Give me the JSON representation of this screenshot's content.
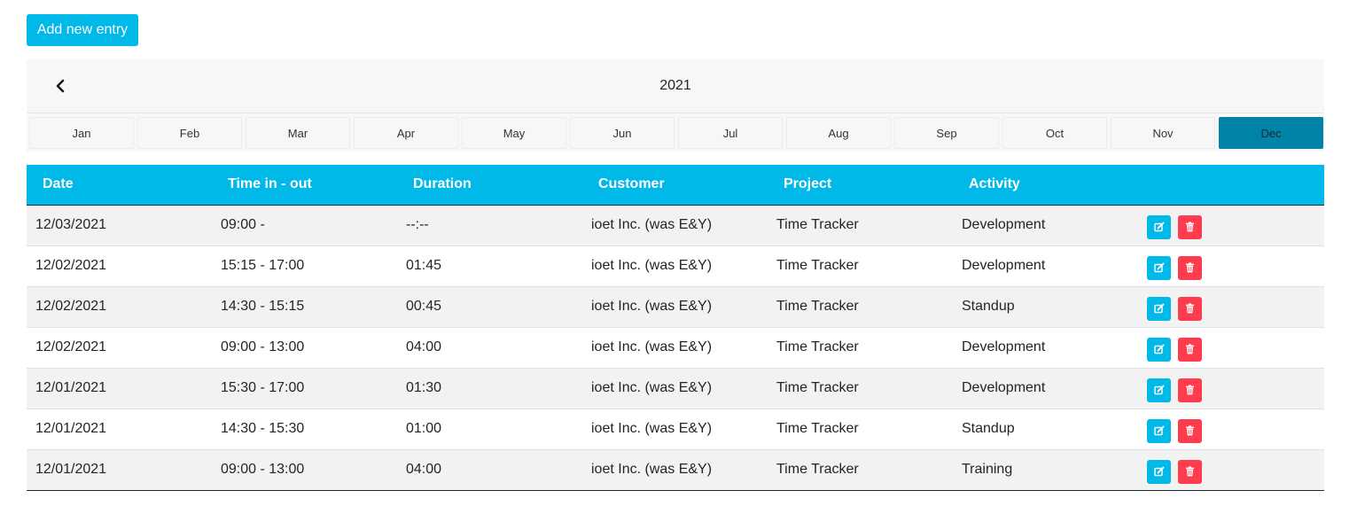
{
  "toolbar": {
    "add_label": "Add new entry"
  },
  "calendar": {
    "year": "2021",
    "months": [
      "Jan",
      "Feb",
      "Mar",
      "Apr",
      "May",
      "Jun",
      "Jul",
      "Aug",
      "Sep",
      "Oct",
      "Nov",
      "Dec"
    ],
    "selected_month": "Dec",
    "prev_icon": "chevron-left-icon"
  },
  "table": {
    "columns": [
      "Date",
      "Time in - out",
      "Duration",
      "Customer",
      "Project",
      "Activity"
    ],
    "rows": [
      {
        "date": "12/03/2021",
        "time": "09:00 -",
        "duration": "--:--",
        "customer": "ioet Inc. (was E&Y)",
        "project": "Time Tracker",
        "activity": "Development"
      },
      {
        "date": "12/02/2021",
        "time": "15:15 - 17:00",
        "duration": "01:45",
        "customer": "ioet Inc. (was E&Y)",
        "project": "Time Tracker",
        "activity": "Development"
      },
      {
        "date": "12/02/2021",
        "time": "14:30 - 15:15",
        "duration": "00:45",
        "customer": "ioet Inc. (was E&Y)",
        "project": "Time Tracker",
        "activity": "Standup"
      },
      {
        "date": "12/02/2021",
        "time": "09:00 - 13:00",
        "duration": "04:00",
        "customer": "ioet Inc. (was E&Y)",
        "project": "Time Tracker",
        "activity": "Development"
      },
      {
        "date": "12/01/2021",
        "time": "15:30 - 17:00",
        "duration": "01:30",
        "customer": "ioet Inc. (was E&Y)",
        "project": "Time Tracker",
        "activity": "Development"
      },
      {
        "date": "12/01/2021",
        "time": "14:30 - 15:30",
        "duration": "01:00",
        "customer": "ioet Inc. (was E&Y)",
        "project": "Time Tracker",
        "activity": "Standup"
      },
      {
        "date": "12/01/2021",
        "time": "09:00 - 13:00",
        "duration": "04:00",
        "customer": "ioet Inc. (was E&Y)",
        "project": "Time Tracker",
        "activity": "Training"
      }
    ],
    "row_actions": {
      "edit_icon": "edit-icon",
      "delete_icon": "trash-icon"
    }
  },
  "colors": {
    "accent": "#00b9e9",
    "selected_month": "#0083a8",
    "danger": "#ff3b4e"
  }
}
